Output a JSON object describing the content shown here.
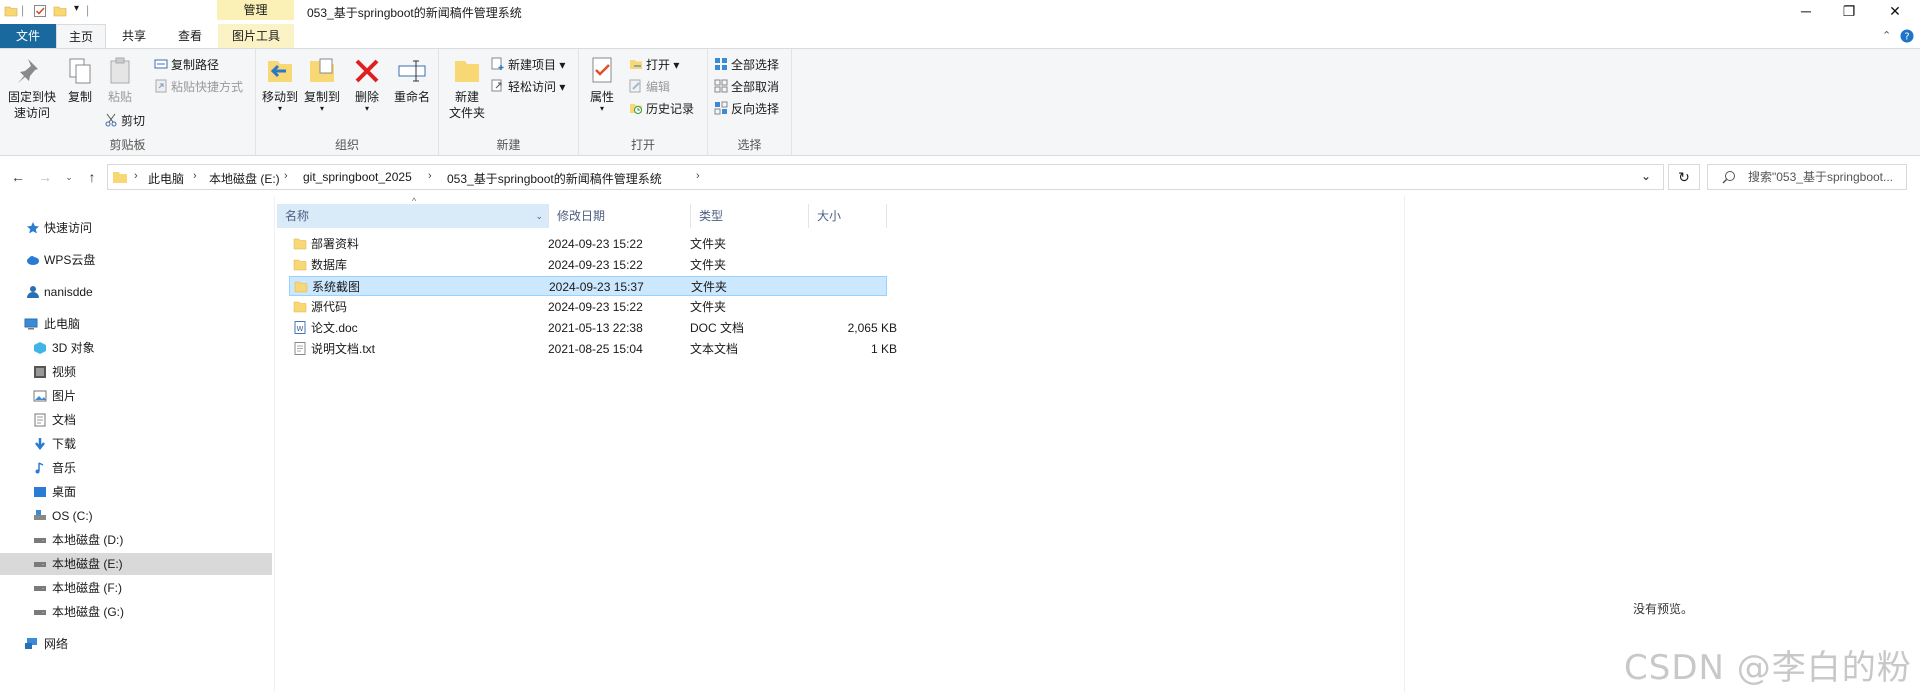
{
  "titlebar": {
    "manage_label": "管理",
    "window_title": "053_基于springboot的新闻稿件管理系统",
    "minimize_glyph": "─",
    "restore_glyph": "❐",
    "close_glyph": "✕"
  },
  "tabs": {
    "file": "文件",
    "home": "主页",
    "share": "共享",
    "view": "查看",
    "picture_tools": "图片工具"
  },
  "ribbon": {
    "clipboard": {
      "label": "剪贴板",
      "pin_line1": "固定到快",
      "pin_line2": "速访问",
      "copy": "复制",
      "paste": "粘贴",
      "copy_path": "复制路径",
      "paste_shortcut": "粘贴快捷方式",
      "cut": "剪切"
    },
    "organize": {
      "label": "组织",
      "move_to": "移动到",
      "copy_to": "复制到",
      "delete": "删除",
      "rename": "重命名"
    },
    "new": {
      "label": "新建",
      "new_folder_line1": "新建",
      "new_folder_line2": "文件夹",
      "new_item": "新建项目 ▾",
      "easy_access": "轻松访问 ▾"
    },
    "open": {
      "label": "打开",
      "properties": "属性",
      "open": "打开 ▾",
      "edit": "编辑",
      "history": "历史记录"
    },
    "select": {
      "label": "选择",
      "select_all": "全部选择",
      "select_none": "全部取消",
      "invert": "反向选择"
    }
  },
  "address": {
    "crumbs": [
      "此电脑",
      "本地磁盘 (E:)",
      "git_springboot_2025",
      "053_基于springboot的新闻稿件管理系统"
    ],
    "search_placeholder": "搜索\"053_基于springboot..."
  },
  "navpane": {
    "quick_access": "快速访问",
    "wps": "WPS云盘",
    "user": "nanisdde",
    "this_pc": "此电脑",
    "items": [
      "3D 对象",
      "视频",
      "图片",
      "文档",
      "下载",
      "音乐",
      "桌面",
      "OS (C:)",
      "本地磁盘 (D:)",
      "本地磁盘 (E:)",
      "本地磁盘 (F:)",
      "本地磁盘 (G:)"
    ],
    "network": "网络"
  },
  "filelist": {
    "columns": [
      "名称",
      "修改日期",
      "类型",
      "大小"
    ],
    "rows": [
      {
        "name": "部署资料",
        "date": "2024-09-23 15:22",
        "type": "文件夹",
        "size": ""
      },
      {
        "name": "数据库",
        "date": "2024-09-23 15:22",
        "type": "文件夹",
        "size": ""
      },
      {
        "name": "系统截图",
        "date": "2024-09-23 15:37",
        "type": "文件夹",
        "size": ""
      },
      {
        "name": "源代码",
        "date": "2024-09-23 15:22",
        "type": "文件夹",
        "size": ""
      },
      {
        "name": "论文.doc",
        "date": "2021-05-13 22:38",
        "type": "DOC 文档",
        "size": "2,065 KB"
      },
      {
        "name": "说明文档.txt",
        "date": "2021-08-25 15:04",
        "type": "文本文档",
        "size": "1 KB"
      }
    ],
    "selected_row": 2
  },
  "preview": {
    "text": "没有预览。"
  },
  "watermark": "CSDN @李白的粉",
  "colors": {
    "file_tab": "#19699f",
    "selection": "#cce8ff",
    "manage_tab": "#fbf0b5",
    "folder": "#f8d775"
  }
}
